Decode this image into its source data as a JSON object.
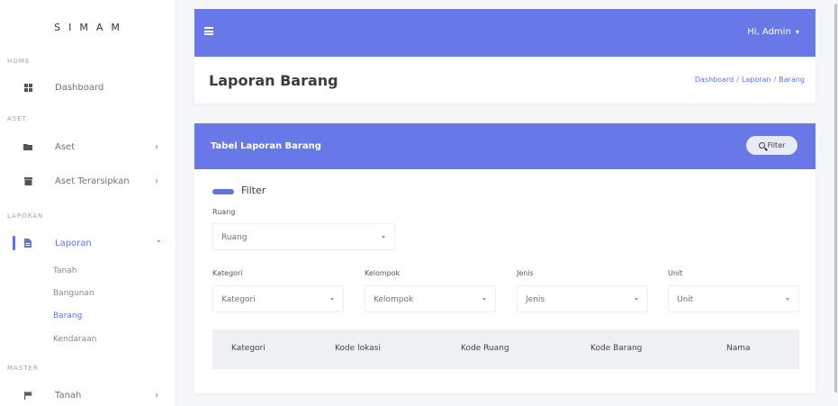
{
  "sidebar": {
    "brand": "SIMAM",
    "sections": {
      "home": "HOME",
      "aset": "ASET",
      "laporan": "LAPORAN",
      "master": "MASTER"
    },
    "items": {
      "dashboard": {
        "label": "Dashboard",
        "icon": "grid-icon"
      },
      "aset": {
        "label": "Aset",
        "icon": "folder-icon"
      },
      "aset_terarsipkan": {
        "label": "Aset Terarsipkan",
        "icon": "archive-icon"
      },
      "laporan": {
        "label": "Laporan",
        "icon": "file-icon"
      },
      "tanah_master": {
        "label": "Tanah",
        "icon": "flag-icon"
      }
    },
    "laporan_sub": [
      "Tanah",
      "Bangunan",
      "Barang",
      "Kendaraan"
    ],
    "chevron_right": "›",
    "chevron_down": "⌄"
  },
  "topbar": {
    "user": "Hi, Admin",
    "caret": "▾"
  },
  "header": {
    "title": "Laporan Barang",
    "breadcrumb": [
      "Dashboard",
      "Laporan",
      "Barang"
    ],
    "sep": "/"
  },
  "card": {
    "title": "Tabel Laporan Barang",
    "filter_button": "Filter",
    "filter_toggle_label": "Filter",
    "fields": {
      "ruang": {
        "label": "Ruang",
        "value": "Ruang"
      },
      "kategori": {
        "label": "Kategori",
        "value": "Kategori"
      },
      "kelompok": {
        "label": "Kelompok",
        "value": "Kelompok"
      },
      "jenis": {
        "label": "Jenis",
        "value": "Jenis"
      },
      "unit": {
        "label": "Unit",
        "value": "Unit"
      }
    },
    "table_headers": [
      "Kategori",
      "Kode lokasi",
      "Kode Ruang",
      "Kode Barang",
      "Nama"
    ]
  },
  "colors": {
    "accent": "#5e72e4",
    "header_bg": "#6878e6"
  }
}
